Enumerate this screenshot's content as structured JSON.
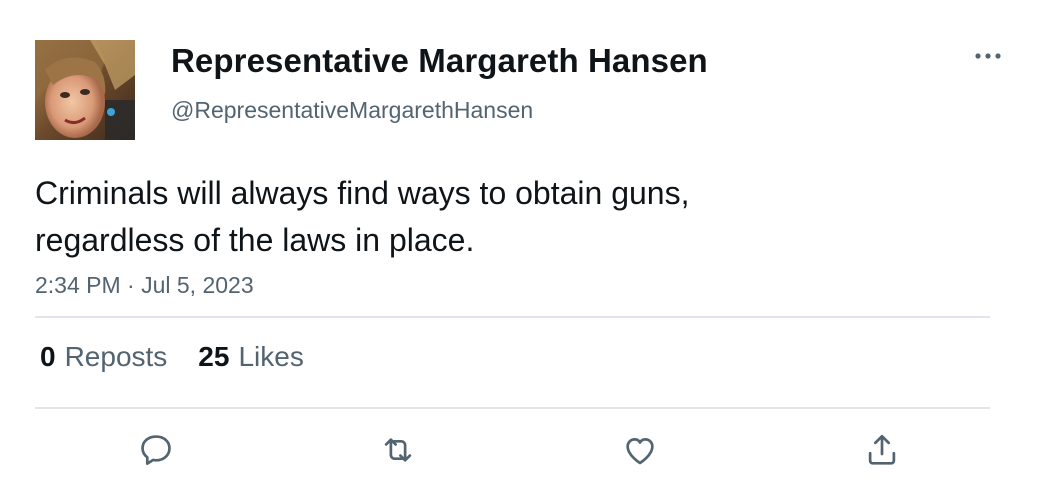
{
  "author": {
    "display_name": "Representative Margareth Hansen",
    "handle": "@RepresentativeMargarethHansen",
    "avatar_icon": "profile-photo"
  },
  "tweet": {
    "text_lines": [
      "Criminals will always find ways to obtain guns,",
      "regardless of the laws in place."
    ],
    "timestamp": "2:34 PM · Jul 5, 2023"
  },
  "stats": {
    "reposts_count": "0",
    "reposts_label": "Reposts",
    "likes_count": "25",
    "likes_label": "Likes"
  },
  "actions": {
    "reply_icon": "speech-bubble-icon",
    "repost_icon": "repost-arrows-icon",
    "like_icon": "heart-icon",
    "share_icon": "share-upload-icon"
  },
  "colors": {
    "text_primary": "#0f1419",
    "text_secondary": "#536471",
    "divider": "#e1e5e9",
    "icon": "#536471"
  }
}
